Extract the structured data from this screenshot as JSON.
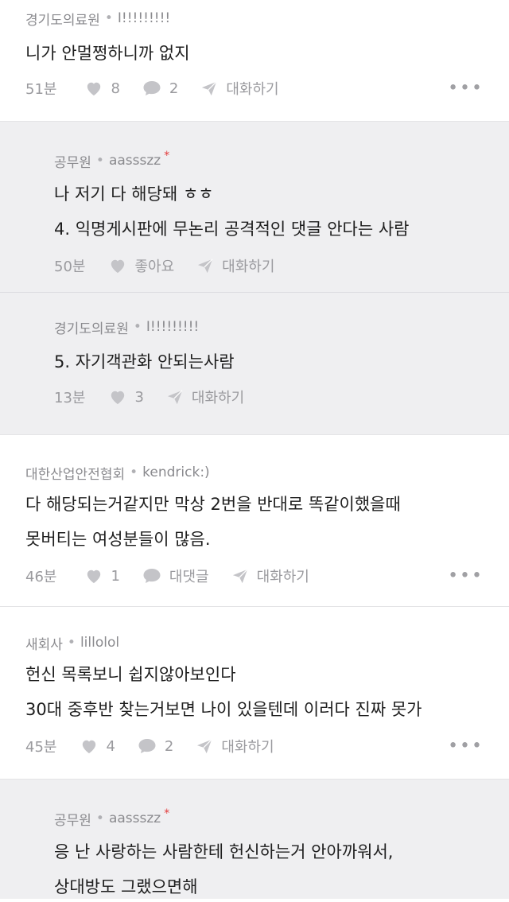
{
  "comments": [
    {
      "author": "경기도의료원",
      "nick": "I!!!!!!!!!",
      "star": false,
      "lines": [
        "니가 안멀쩡하니까 없지"
      ],
      "time": "51분",
      "like": "8",
      "comment": "2",
      "chat": "대화하기"
    },
    {
      "author": "공무원",
      "nick": "aassszz",
      "star": true,
      "lines": [
        "나 저기 다 해당돼 ㅎㅎ",
        "4. 익명게시판에 무논리 공격적인 댓글 안다는 사람"
      ],
      "time": "50분",
      "like": "좋아요",
      "chat": "대화하기"
    },
    {
      "author": "경기도의료원",
      "nick": "I!!!!!!!!!",
      "star": false,
      "lines": [
        "5. 자기객관화 안되는사람"
      ],
      "time": "13분",
      "like": "3",
      "chat": "대화하기"
    },
    {
      "author": "대한산업안전협회",
      "nick": "kendrick:)",
      "star": false,
      "lines": [
        "다 해당되는거같지만 막상 2번을 반대로 똑같이했을때",
        "못버티는 여성분들이 많음."
      ],
      "time": "46분",
      "like": "1",
      "comment": "대댓글",
      "chat": "대화하기"
    },
    {
      "author": "새회사",
      "nick": "lillolol",
      "star": false,
      "lines": [
        "헌신 목록보니 쉽지않아보인다",
        "30대 중후반 찾는거보면 나이 있을텐데 이러다 진짜 못가"
      ],
      "time": "45분",
      "like": "4",
      "comment": "2",
      "chat": "대화하기"
    },
    {
      "author": "공무원",
      "nick": "aassszz",
      "star": true,
      "lines": [
        "응 난 사랑하는 사람한테 헌신하는거 안아까워서,",
        "상대방도 그랬으면해"
      ]
    }
  ],
  "icons": {
    "like": "heart-icon",
    "comment": "speech-bubble-icon",
    "chat": "send-icon",
    "more": "more-dots-icon"
  },
  "colors": {
    "reply_bg": "#efeff1",
    "meta": "#8a8a8e",
    "star": "#e23b3b"
  }
}
